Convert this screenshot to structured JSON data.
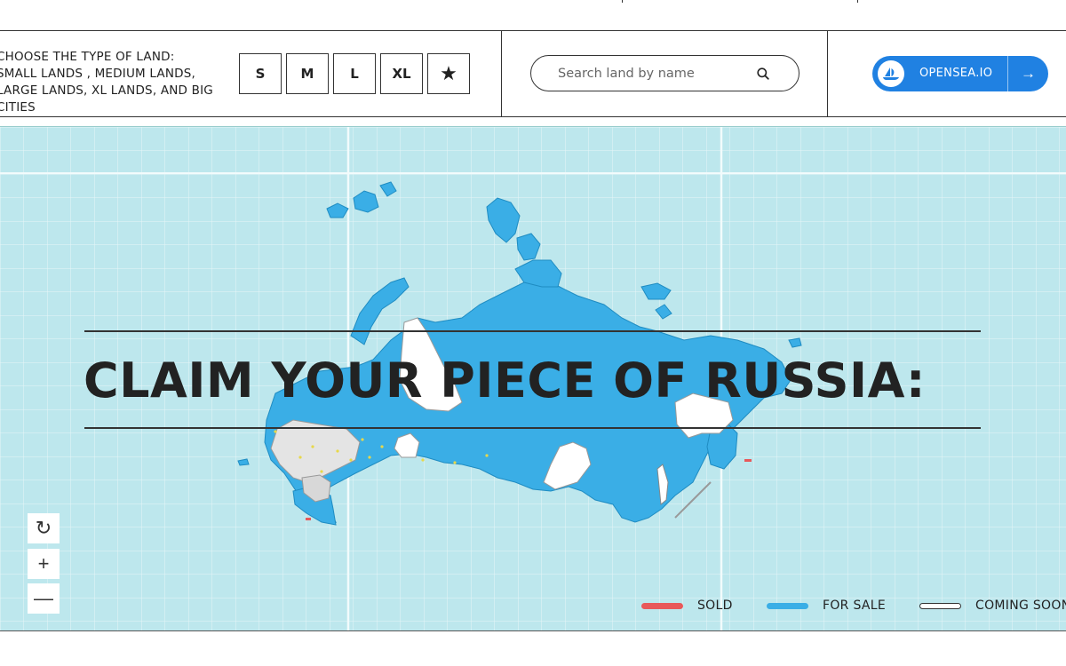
{
  "filter": {
    "prompt": "CHOOSE THE TYPE OF LAND: SMALL LANDS , MEDIUM LANDS, LARGE LANDS, XL LANDS, AND BIG CITIES",
    "sizes": [
      "S",
      "M",
      "L",
      "XL",
      "★"
    ]
  },
  "search": {
    "placeholder": "Search land by name",
    "icon": "search-icon"
  },
  "opensea": {
    "label": "OPENSEA.IO",
    "arrow": "→",
    "color": "#2081e2"
  },
  "map": {
    "title": "CLAIM YOUR PIECE OF RUSSIA:",
    "background": "#bde7ed",
    "land_color": "#3aaee6",
    "controls": {
      "refresh": "↻",
      "zoom_in": "+",
      "zoom_out": "—"
    },
    "legend": [
      {
        "label": "SOLD",
        "color": "#e8585a"
      },
      {
        "label": "FOR SALE",
        "color": "#3aaee6"
      },
      {
        "label": "COMING SOON",
        "color": "#ffffff"
      }
    ]
  }
}
